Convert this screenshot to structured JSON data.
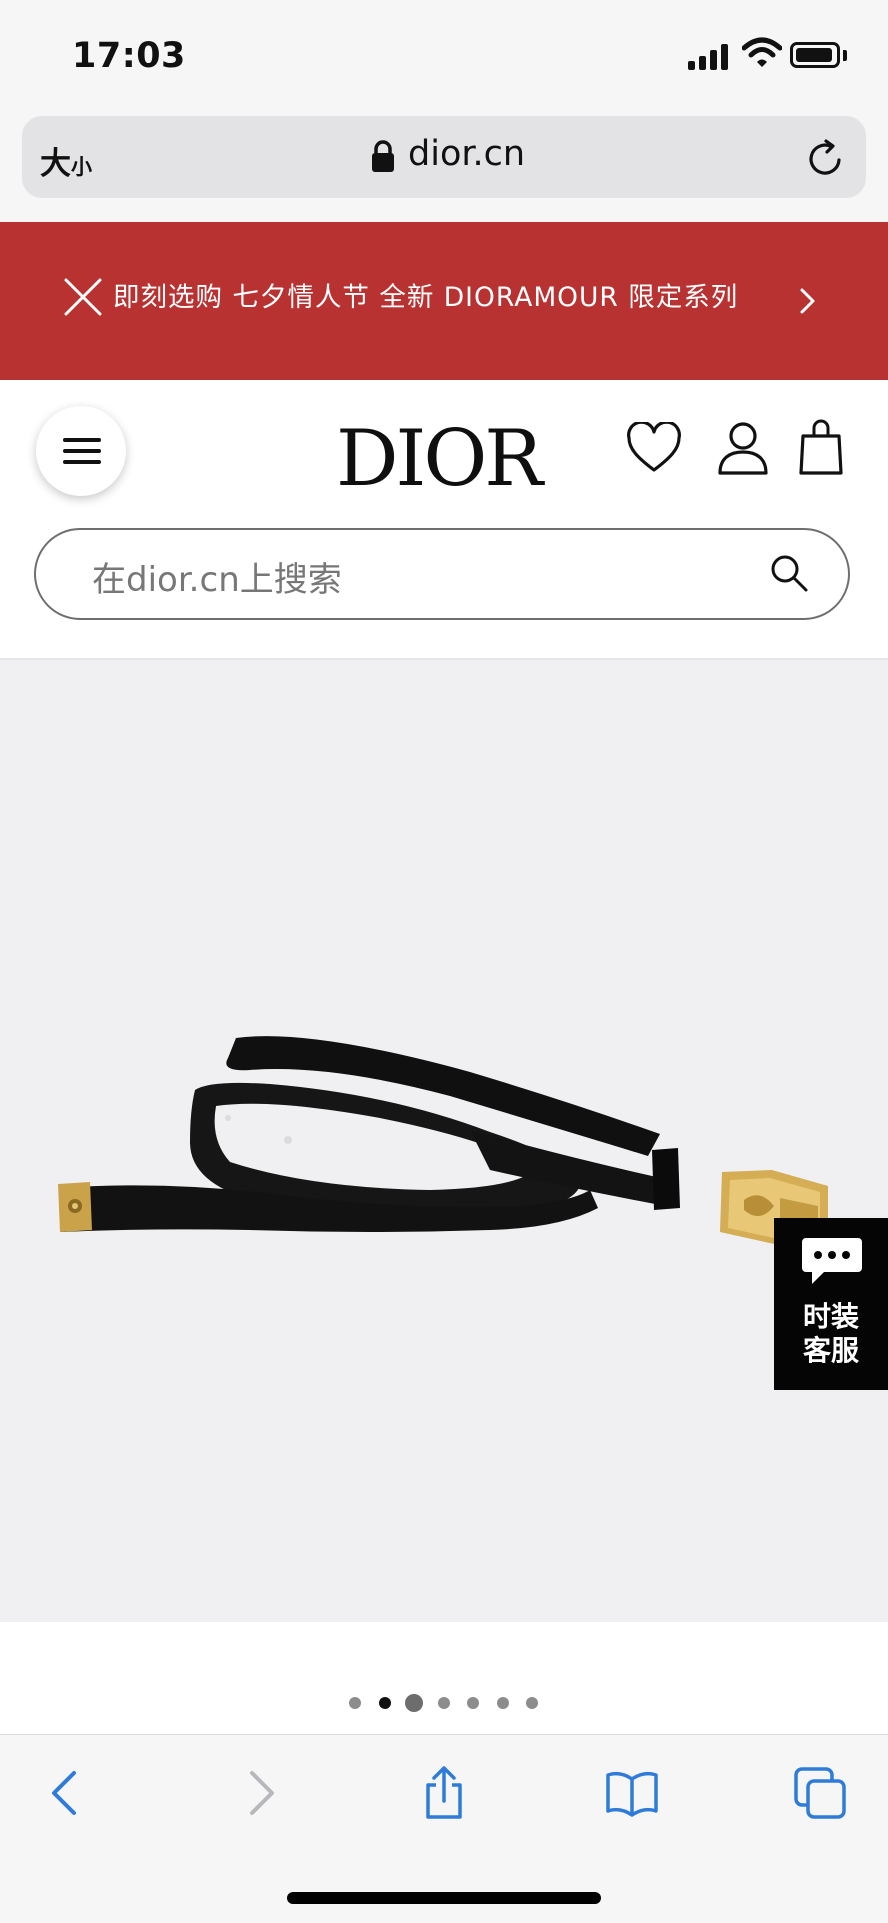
{
  "status_bar": {
    "time": "17:03"
  },
  "address_bar": {
    "text_size_large": "大",
    "text_size_small": "小",
    "url": "dior.cn"
  },
  "promo": {
    "text": "即刻选购 七夕情人节 全新 DIORAMOUR 限定系列",
    "background": "#b83232"
  },
  "header": {
    "logo": "DIOR",
    "search_placeholder": "在dior.cn上搜索"
  },
  "chat": {
    "label_line1": "时装",
    "label_line2": "客服"
  },
  "carousel": {
    "total": 7,
    "active_index": 1
  },
  "icons": {
    "menu": "hamburger-icon",
    "wishlist": "heart-icon",
    "account": "user-icon",
    "cart": "bag-icon",
    "search": "search-icon",
    "chat": "chat-bubble-icon",
    "back": "chevron-left-icon",
    "forward": "chevron-right-icon",
    "share": "share-icon",
    "bookmarks": "book-icon",
    "tabs": "tabs-icon"
  },
  "colors": {
    "browser_accent": "#2f7bd8",
    "promo": "#b83232",
    "chat_bg": "#050505"
  }
}
